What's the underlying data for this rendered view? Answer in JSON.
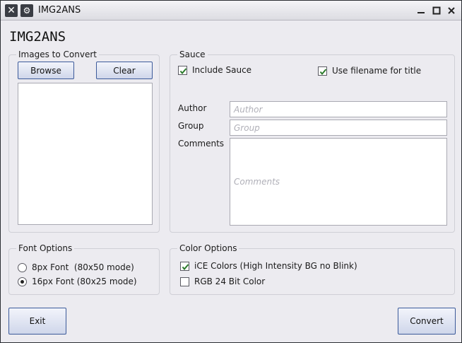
{
  "window": {
    "title": "IMG2ANS",
    "controls": {
      "close_left": "✕",
      "settings": "⚙",
      "minimize": "▁",
      "maximize": "□",
      "close": "✕"
    }
  },
  "app_title": "IMG2ANS",
  "images": {
    "legend": "Images to Convert",
    "browse_label": "Browse",
    "clear_label": "Clear"
  },
  "sauce": {
    "legend": "Sauce",
    "include_sauce": {
      "label": "Include Sauce",
      "checked": true
    },
    "use_filename": {
      "label": "Use filename for title",
      "checked": true
    },
    "author": {
      "label": "Author",
      "placeholder": "Author",
      "value": ""
    },
    "group": {
      "label": "Group",
      "placeholder": "Group",
      "value": ""
    },
    "comments": {
      "label": "Comments",
      "placeholder": "Comments",
      "value": ""
    }
  },
  "font_options": {
    "legend": "Font Options",
    "options": [
      {
        "label": "8px Font  (80x50 mode)",
        "selected": false
      },
      {
        "label": "16px Font (80x25 mode)",
        "selected": true
      }
    ]
  },
  "color_options": {
    "legend": "Color Options",
    "ice": {
      "label": "iCE Colors (High Intensity BG no Blink)",
      "checked": true
    },
    "rgb": {
      "label": "RGB 24 Bit Color",
      "checked": false
    }
  },
  "footer": {
    "exit_label": "Exit",
    "convert_label": "Convert"
  }
}
